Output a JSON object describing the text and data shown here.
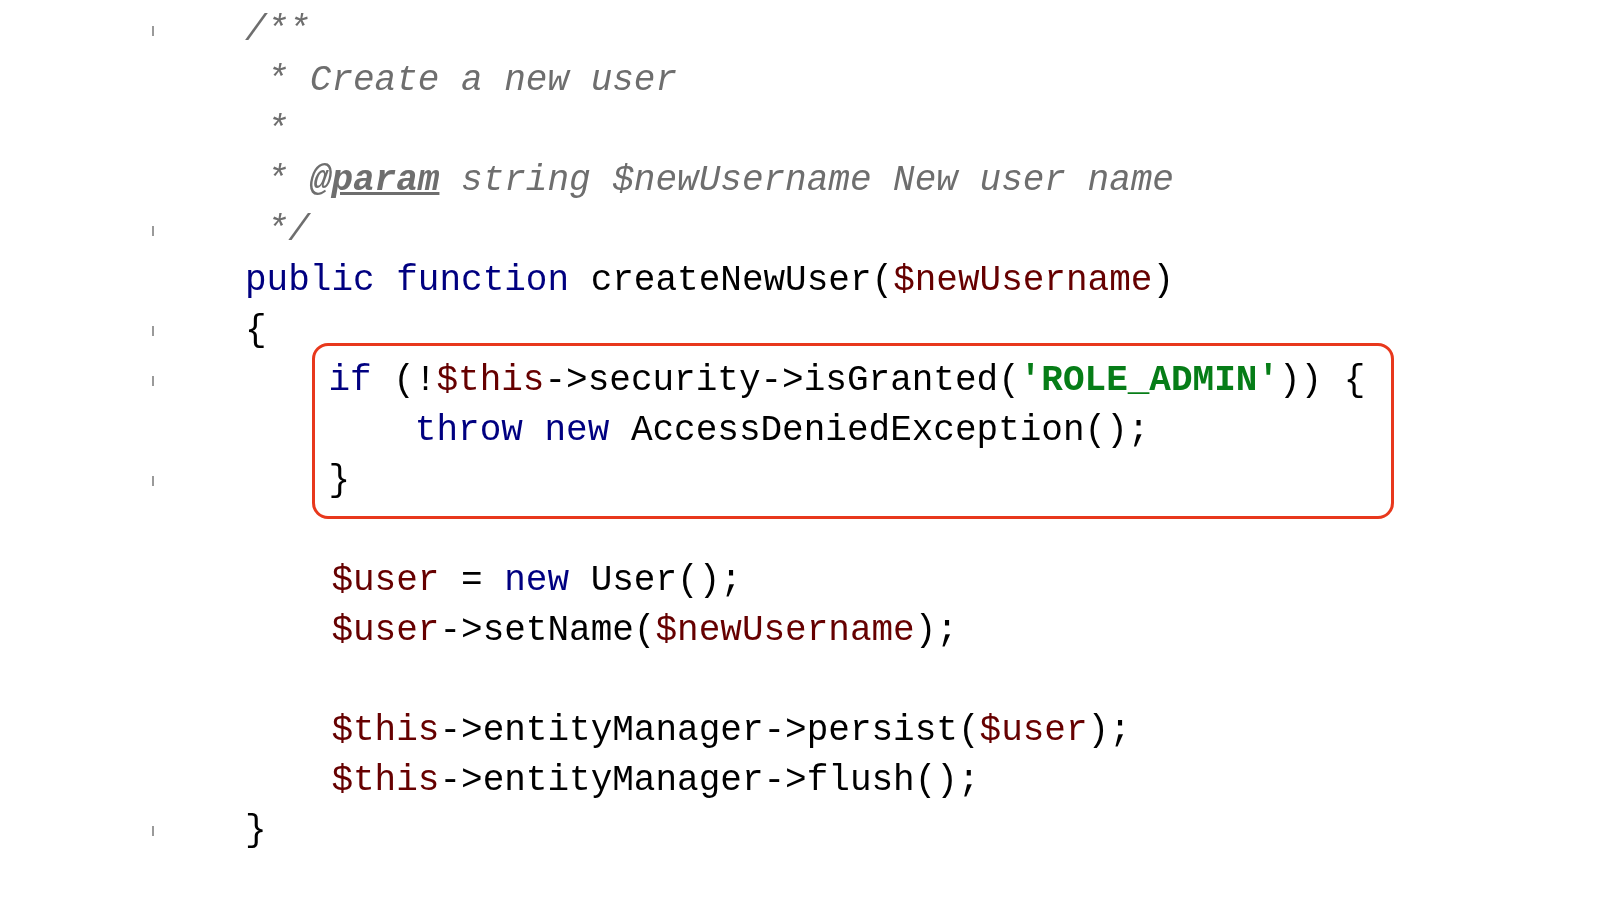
{
  "editor": {
    "lines": [
      {
        "fold_mark": true,
        "highlighted": false,
        "tokens": [
          {
            "kind": "comment",
            "text": "/**"
          }
        ]
      },
      {
        "fold_mark": false,
        "highlighted": false,
        "tokens": [
          {
            "kind": "comment",
            "text": " * Create a new user"
          }
        ]
      },
      {
        "fold_mark": false,
        "highlighted": false,
        "tokens": [
          {
            "kind": "comment",
            "text": " *"
          }
        ]
      },
      {
        "fold_mark": false,
        "highlighted": false,
        "tokens": [
          {
            "kind": "comment",
            "text": " * "
          },
          {
            "kind": "doc_tag",
            "text": "@param"
          },
          {
            "kind": "comment",
            "text": " string $newUsername New user name"
          }
        ]
      },
      {
        "fold_mark": true,
        "highlighted": false,
        "tokens": [
          {
            "kind": "comment",
            "text": " */"
          }
        ]
      },
      {
        "fold_mark": false,
        "highlighted": false,
        "tokens": [
          {
            "kind": "keyword",
            "text": "public"
          },
          {
            "kind": "keyword",
            "text": " function"
          },
          {
            "kind": "plain",
            "text": " createNewUser("
          },
          {
            "kind": "variable",
            "text": "$newUsername"
          },
          {
            "kind": "plain",
            "text": ")"
          }
        ]
      },
      {
        "fold_mark": true,
        "highlighted": false,
        "tokens": [
          {
            "kind": "plain",
            "text": "{"
          }
        ]
      },
      {
        "fold_mark": true,
        "highlighted": true,
        "tokens": [
          {
            "kind": "keyword",
            "text": "    if"
          },
          {
            "kind": "plain",
            "text": " (!"
          },
          {
            "kind": "variable",
            "text": "$this"
          },
          {
            "kind": "plain",
            "text": "->security->isGranted("
          },
          {
            "kind": "string",
            "text": "'ROLE_ADMIN'"
          },
          {
            "kind": "plain",
            "text": ")) {"
          }
        ]
      },
      {
        "fold_mark": false,
        "highlighted": true,
        "tokens": [
          {
            "kind": "keyword",
            "text": "        throw"
          },
          {
            "kind": "keyword",
            "text": " new"
          },
          {
            "kind": "plain",
            "text": " AccessDeniedException();"
          }
        ]
      },
      {
        "fold_mark": true,
        "highlighted": true,
        "tokens": [
          {
            "kind": "plain",
            "text": "    }"
          }
        ]
      },
      {
        "fold_mark": false,
        "highlighted": false
      },
      {
        "fold_mark": false,
        "highlighted": false,
        "tokens": [
          {
            "kind": "variable",
            "text": "    $user"
          },
          {
            "kind": "plain",
            "text": " = "
          },
          {
            "kind": "keyword",
            "text": "new"
          },
          {
            "kind": "plain",
            "text": " User();"
          }
        ]
      },
      {
        "fold_mark": false,
        "highlighted": false,
        "tokens": [
          {
            "kind": "variable",
            "text": "    $user"
          },
          {
            "kind": "plain",
            "text": "->setName("
          },
          {
            "kind": "variable",
            "text": "$newUsername"
          },
          {
            "kind": "plain",
            "text": ");"
          }
        ]
      },
      {
        "fold_mark": false,
        "highlighted": false
      },
      {
        "fold_mark": false,
        "highlighted": false,
        "tokens": [
          {
            "kind": "variable",
            "text": "    $this"
          },
          {
            "kind": "plain",
            "text": "->entityManager->persist("
          },
          {
            "kind": "variable",
            "text": "$user"
          },
          {
            "kind": "plain",
            "text": ");"
          }
        ]
      },
      {
        "fold_mark": false,
        "highlighted": false,
        "tokens": [
          {
            "kind": "variable",
            "text": "    $this"
          },
          {
            "kind": "plain",
            "text": "->entityManager->flush();"
          }
        ]
      },
      {
        "fold_mark": true,
        "highlighted": false,
        "tokens": [
          {
            "kind": "plain",
            "text": "}"
          }
        ]
      }
    ]
  }
}
